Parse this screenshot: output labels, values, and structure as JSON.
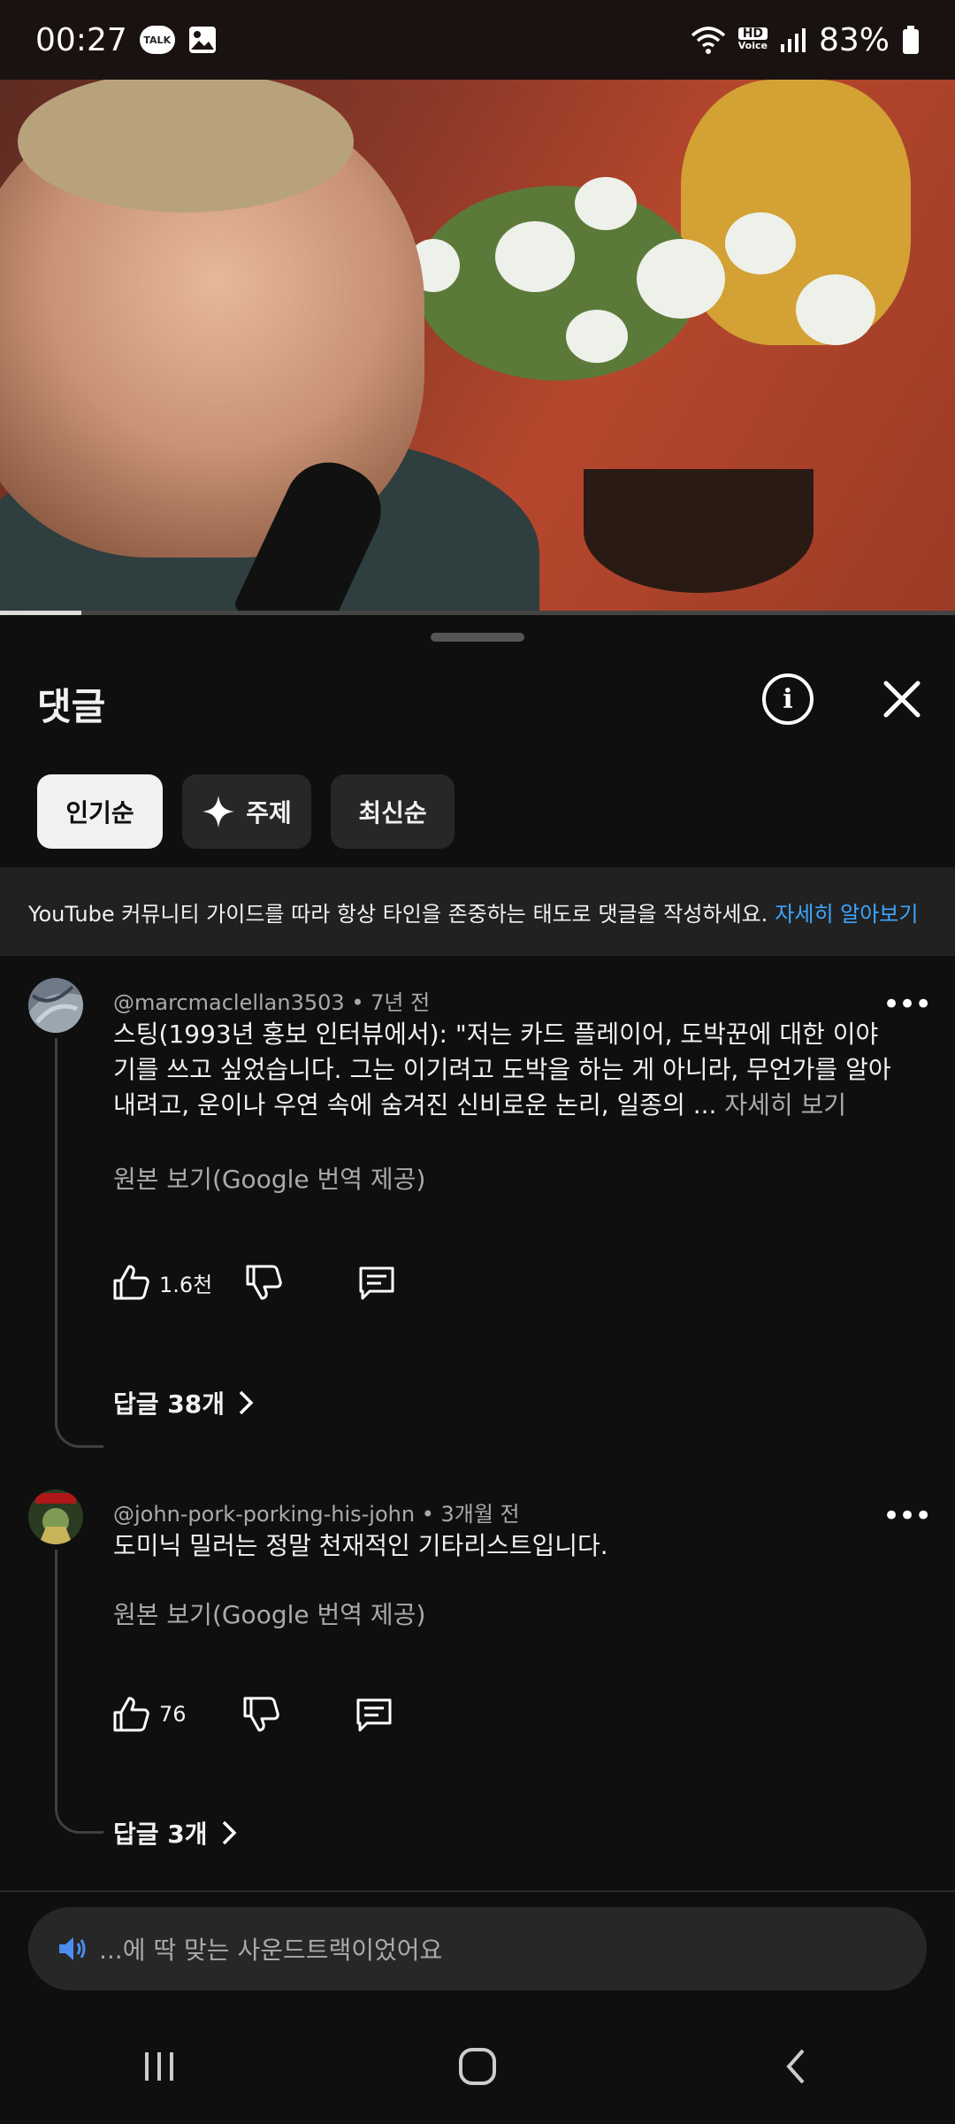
{
  "status_bar": {
    "time": "00:27",
    "talk_label": "TALK",
    "hd_label": "HD",
    "voice_label": "Voice",
    "battery": "83%"
  },
  "video": {
    "progress_fraction": 0.085
  },
  "sheet": {
    "title": "댓글",
    "chips": [
      {
        "label": "인기순",
        "active": true
      },
      {
        "label": "주제",
        "active": false
      },
      {
        "label": "최신순",
        "active": false
      }
    ],
    "guideline": {
      "text": "YouTube 커뮤니티 가이드를 따라 항상 타인을 존중하는 태도로 댓글을 작성하세요.",
      "link": "자세히 알아보기"
    }
  },
  "comments": [
    {
      "author": "@marcmaclellan3503",
      "age": "7년 전",
      "text": "스팅(1993년 홍보 인터뷰에서): \"저는 카드 플레이어, 도박꾼에 대한 이야기를 쓰고 싶었습니다. 그는 이기려고 도박을 하는 게 아니라, 무언가를 알아내려고, 운이나 우연 속에 숨겨진 신비로운 논리, 일종의 ...",
      "read_more": "자세히 보기",
      "translate": "원본 보기(Google 번역 제공)",
      "likes": "1.6천",
      "replies": "답글 38개"
    },
    {
      "author": "@john-pork-porking-his-john",
      "age": "3개월 전",
      "text": "도미닉 밀러는 정말 천재적인 기타리스트입니다.",
      "translate": "원본 보기(Google 번역 제공)",
      "likes": "76",
      "replies": "답글 3개"
    }
  ],
  "input": {
    "placeholder": "...에 딱 맞는 사운드트랙이었어요",
    "icon": "speaker-icon"
  },
  "colors": {
    "background": "#0f0f0f",
    "link": "#3ea6ff",
    "chip_active": "#f1f1f1",
    "chip": "#272727"
  }
}
